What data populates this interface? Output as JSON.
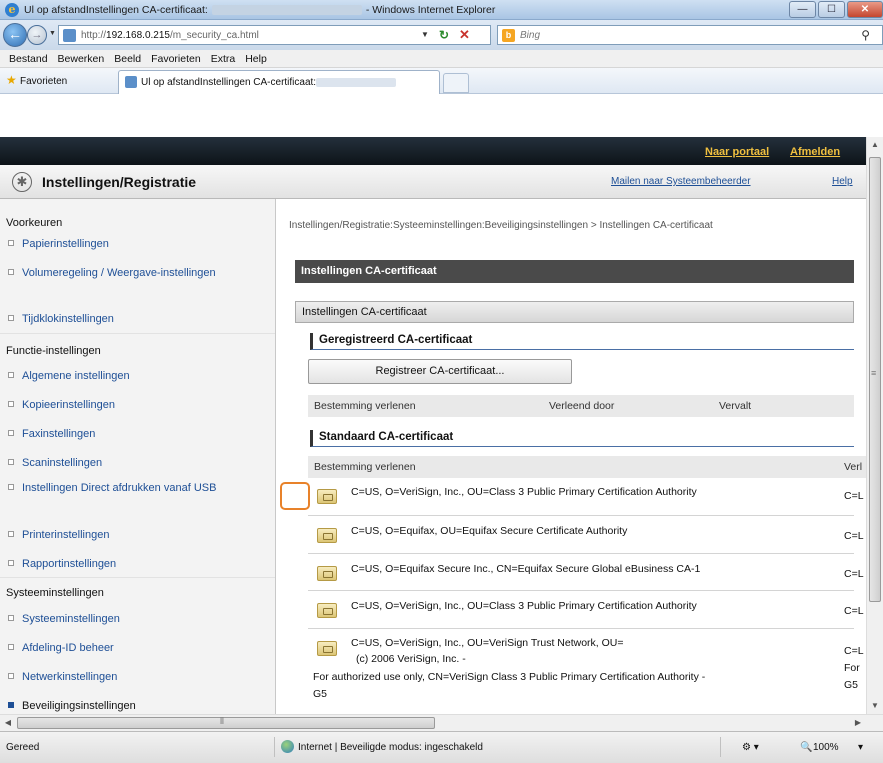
{
  "window": {
    "title_left": "Ul op afstandInstellingen CA-certificaat:",
    "title_right": "- Windows Internet Explorer",
    "minimize": "—",
    "maximize": "☐",
    "close": "✕"
  },
  "addressbar": {
    "url_prefix": "http://",
    "url_host": "192.168.0.215",
    "url_path": "/m_security_ca.html",
    "search_placeholder": "Bing"
  },
  "menu": [
    "Bestand",
    "Bewerken",
    "Beeld",
    "Favorieten",
    "Extra",
    "Help"
  ],
  "favorites": {
    "label": "Favorieten",
    "tab_title": "Ul op afstandInstellingen CA-certificaat:"
  },
  "header": {
    "portal_link": "Naar portaal",
    "logout_link": "Afmelden",
    "page_title": "Instellingen/Registratie",
    "mail_admin_link": "Mailen naar Systeembeheerder",
    "help_link": "Help"
  },
  "leftnav": {
    "sections": [
      {
        "title": "Voorkeuren",
        "items": [
          "Papierinstellingen",
          "Volumeregeling / Weergave-instellingen",
          "Tijdklokinstellingen"
        ]
      },
      {
        "title": "Functie-instellingen",
        "items": [
          "Algemene instellingen",
          "Kopieerinstellingen",
          "Faxinstellingen",
          "Scaninstellingen",
          "Instellingen Direct afdrukken vanaf USB",
          "Printerinstellingen",
          "Rapportinstellingen"
        ]
      },
      {
        "title": "Systeeminstellingen",
        "items": [
          "Systeeminstellingen",
          "Afdeling-ID beheer",
          "Netwerkinstellingen",
          "Beveiligingsinstellingen"
        ]
      }
    ],
    "active_item": "Beveiligingsinstellingen"
  },
  "content": {
    "breadcrumb": "Instellingen/Registratie:Systeeminstellingen:Beveiligingsinstellingen > Instellingen CA-certificaat",
    "main_bar": "Instellingen CA-certificaat",
    "section_bar": "Instellingen CA-certificaat",
    "registered_heading": "Geregistreerd CA-certificaat",
    "register_button": "Registreer CA-certificaat...",
    "registered_columns": [
      "Bestemming verlenen",
      "Verleend door",
      "Vervalt"
    ],
    "standard_heading": "Standaard CA-certificaat",
    "standard_columns": [
      "Bestemming verlenen",
      "Verl"
    ],
    "certificates": [
      {
        "issued_to": "C=US, O=VeriSign, Inc., OU=Class 3 Public Primary Certification Authority",
        "issued_by": "C=L"
      },
      {
        "issued_to": "C=US, O=Equifax, OU=Equifax Secure Certificate Authority",
        "issued_by": "C=L"
      },
      {
        "issued_to": "C=US, O=Equifax Secure Inc., CN=Equifax Secure Global eBusiness CA-1",
        "issued_by": "C=L"
      },
      {
        "issued_to": "C=US, O=VeriSign, Inc., OU=Class 3 Public Primary Certification Authority",
        "issued_by": "C=L"
      },
      {
        "issued_to_lines": [
          "C=US, O=VeriSign, Inc., OU=VeriSign Trust Network, OU=",
          "(c) 2006 VeriSign, Inc. -",
          "For authorized use only, CN=VeriSign Class 3 Public Primary Certification Authority -",
          "G5"
        ],
        "issued_by_lines": [
          "C=L",
          "For",
          "G5"
        ]
      }
    ]
  },
  "statusbar": {
    "status": "Gereed",
    "zone": "Internet | Beveiligde modus: ingeschakeld",
    "zoom": "100%"
  }
}
